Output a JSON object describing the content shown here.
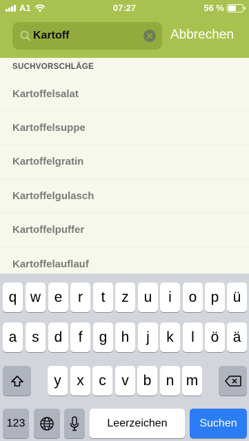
{
  "status": {
    "carrier": "A1",
    "time": "07:27",
    "battery_percent": "56 %",
    "battery_level": 0.56
  },
  "search": {
    "query": "Kartoff",
    "cancel_label": "Abbrechen"
  },
  "suggestions": {
    "title": "SUCHVORSCHLÄGE",
    "items": [
      "Kartoffelsalat",
      "Kartoffelsuppe",
      "Kartoffelgratin",
      "Kartoffelgulasch",
      "Kartoffelpuffer",
      "Kartoffelauflauf"
    ]
  },
  "keyboard": {
    "row1": [
      "q",
      "w",
      "e",
      "r",
      "t",
      "z",
      "u",
      "i",
      "o",
      "p",
      "ü"
    ],
    "row2": [
      "a",
      "s",
      "d",
      "f",
      "g",
      "h",
      "j",
      "k",
      "l",
      "ö",
      "ä"
    ],
    "row3": [
      "y",
      "x",
      "c",
      "v",
      "b",
      "n",
      "m"
    ],
    "numbers_label": "123",
    "space_label": "Leerzeichen",
    "search_label": "Suchen"
  },
  "colors": {
    "header": "#a9c24f",
    "search_field": "#93ab3d",
    "key_accent": "#2c7cf6"
  }
}
